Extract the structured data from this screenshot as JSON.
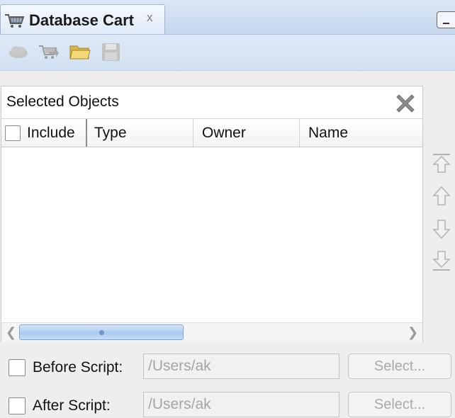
{
  "tab": {
    "title": "Database Cart",
    "close": "x"
  },
  "toolbar": {
    "buttons": [
      {
        "name": "cloud-icon"
      },
      {
        "name": "export-cart-icon"
      },
      {
        "name": "open-folder-icon"
      },
      {
        "name": "save-icon"
      }
    ]
  },
  "panel": {
    "title": "Selected Objects",
    "columns": [
      "Include",
      "Type",
      "Owner",
      "Name"
    ]
  },
  "scripts": {
    "before": {
      "label": "Before Script:",
      "value": "/Users/ak",
      "button": "Select..."
    },
    "after": {
      "label": "After Script:",
      "value": "/Users/ak",
      "button": "Select..."
    }
  },
  "colors": {
    "tab_bg": "#dbe7f6",
    "panel_bg": "#ffffff",
    "disabled_text": "#a5a5a5"
  }
}
